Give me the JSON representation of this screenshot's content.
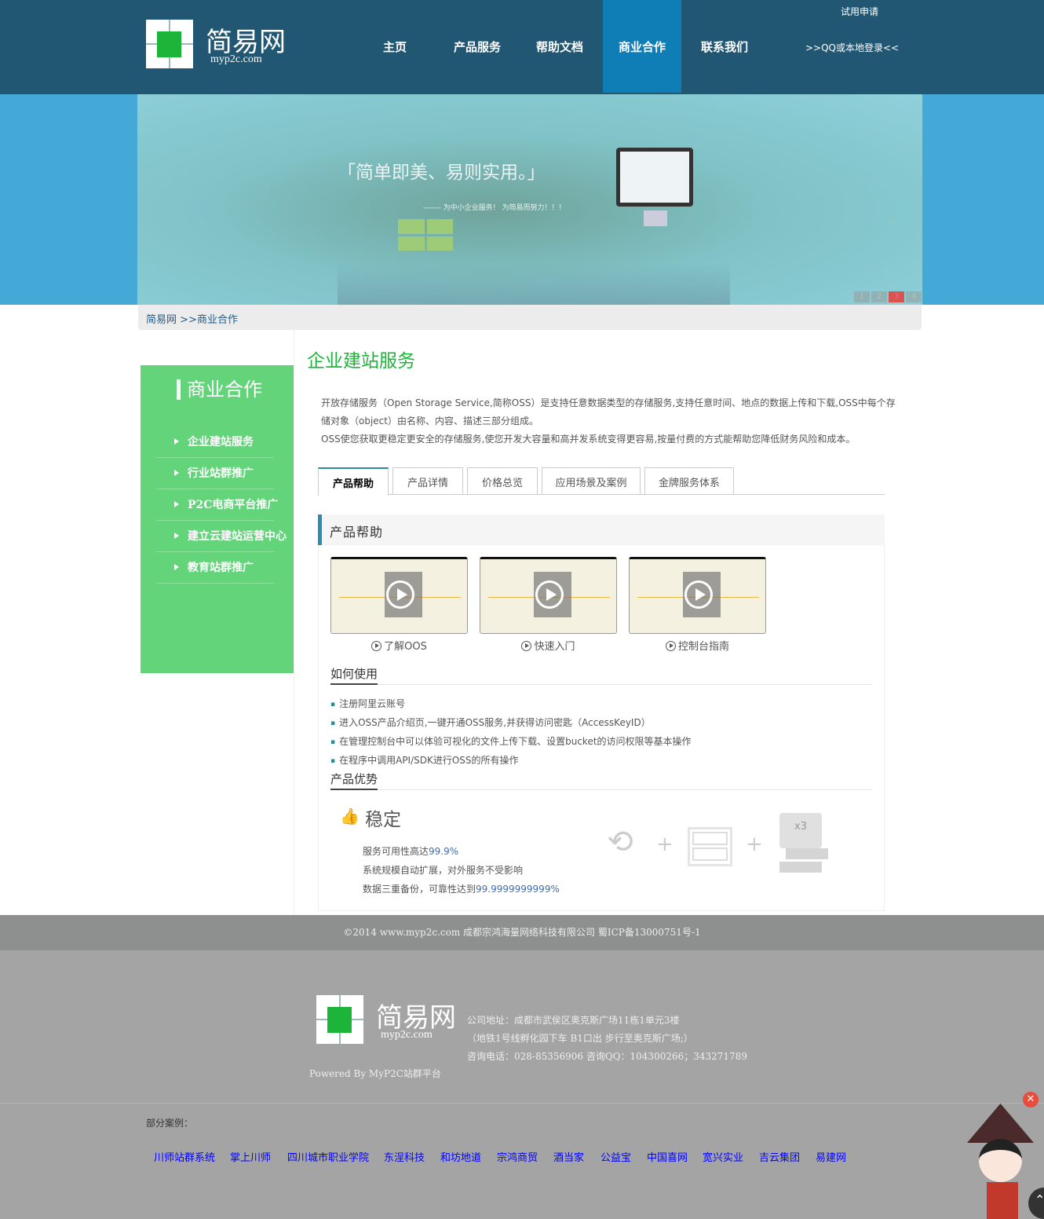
{
  "header": {
    "logo_name": "简易网",
    "logo_url": "myp2c.com",
    "nav": [
      "主页",
      "产品服务",
      "帮助文档",
      "商业合作",
      "联系我们"
    ],
    "active_nav": "商业合作",
    "trial": "试用申请",
    "login": ">>QQ或本地登录<<"
  },
  "banner": {
    "slogan": "「简单即美、易则实用。」",
    "subslogan": "------- 为中小企业服务！ 为简易而努力！！！",
    "dots": [
      "1",
      "2",
      "3",
      "4"
    ],
    "active_dot": "3"
  },
  "breadcrumb": {
    "home": "简易网",
    "current": ">>商业合作"
  },
  "sidebar": {
    "title": "商业合作",
    "items": [
      "企业建站服务",
      "行业站群推广",
      "P2C电商平台推广",
      "建立云建站运营中心",
      "教育站群推广"
    ]
  },
  "main": {
    "title": "企业建站服务",
    "intro": [
      "开放存储服务（Open Storage Service,简称OSS）是支持任意数据类型的存储服务,支持任意时间、地点的数据上传和下载,OSS中每个存储对象（object）由名称、内容、描述三部分组成。",
      "OSS使您获取更稳定更安全的存储服务,使您开发大容量和高并发系统变得更容易,按量付费的方式能帮助您降低财务风险和成本。"
    ],
    "tabs": [
      "产品帮助",
      "产品详情",
      "价格总览",
      "应用场景及案例",
      "金牌服务体系"
    ],
    "panel_title": "产品帮助",
    "videos": [
      "了解OOS",
      "快速入门",
      "控制台指南"
    ],
    "how_title": "如何使用",
    "how_items": [
      "注册阿里云账号",
      "进入OSS产品介绍页,一键开通OSS服务,并获得访问密匙（AccessKeyID）",
      "在管理控制台中可以体验可视化的文件上传下载、设置bucket的访问权限等基本操作",
      "在程序中调用API/SDK进行OSS的所有操作"
    ],
    "adv_title": "产品优势",
    "feature_title": "稳定",
    "features": [
      {
        "text": "服务可用性高达",
        "value": "99.9%"
      },
      {
        "text": "系统规模自动扩展，对外服务不受影响",
        "value": ""
      },
      {
        "text": "数据三重备份，可靠性达到",
        "value": "99.9999999999%"
      }
    ],
    "x3": "x3"
  },
  "footer": {
    "copyright": "©2014  www.myp2c.com  成都宗鸿海量网络科技有限公司  蜀ICP备13000751号-1",
    "address": "公司地址：成都市武侯区奥克斯广场11栋1单元3楼",
    "metro": "（地铁1号线孵化园下车 B1口出 步行至奥克斯广场;）",
    "contact": "咨询电话：028-85356906 咨询QQ：104300266；343271789",
    "powered": "Powered By MyP2C站群平台",
    "cases_label": "部分案例：",
    "cases": [
      "川师站群系统",
      "掌上川师",
      "四川城市职业学院",
      "东浧科技",
      "和坊地道",
      "宗鸿商贸",
      "酒当家",
      "公益宝",
      "中国喜网",
      "宽兴实业",
      "吉云集团",
      "易建网"
    ]
  }
}
